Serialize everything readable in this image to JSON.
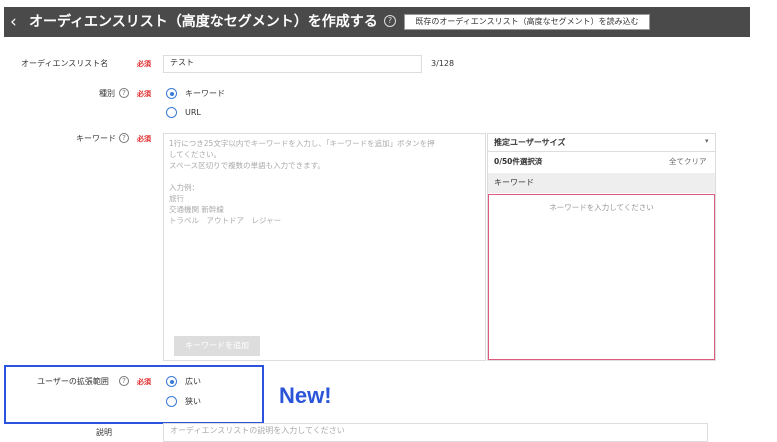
{
  "header": {
    "back_icon": "‹",
    "title": "オーディエンスリスト（高度なセグメント）を作成する",
    "help_icon": "?",
    "load_button": "既存のオーディエンスリスト（高度なセグメント）を読み込む"
  },
  "form": {
    "name": {
      "label": "オーディエンスリスト名",
      "required": "必須",
      "value": "テスト",
      "count": "3/128"
    },
    "type": {
      "label": "種別",
      "required": "必須",
      "options": [
        "キーワード",
        "URL"
      ],
      "selected": "キーワード"
    },
    "keyword": {
      "label": "キーワード",
      "required": "必須",
      "placeholder_lines": [
        "1行につき25文字以内でキーワードを入力し、「キーワードを追加」ボタンを押",
        "してください。",
        "スペース区切りで複数の単語も入力できます。",
        "",
        "入力例：",
        "旅行",
        "交通機関 新幹線",
        "トラベル　アウトドア　レジャー"
      ],
      "add_button": "キーワードを追加"
    },
    "panel": {
      "select": "推定ユーザーサイズ",
      "count": "0/50件選択済",
      "clear": "全てクリア",
      "column": "キーワード",
      "placeholder": "ネーワードを入力してください"
    },
    "range": {
      "label": "ユーザーの拡張範囲",
      "required": "必須",
      "options": [
        "広い",
        "狭い"
      ],
      "selected": "広い"
    },
    "description": {
      "label": "説明",
      "placeholder": "オーディエンスリストの説明を入力してください"
    }
  },
  "badge": {
    "new": "New!"
  },
  "colors": {
    "header": "#4a4a4a",
    "required": "#e02b2b",
    "accent": "#3a7bd5",
    "highlight": "#2b53e0",
    "panel_border": "#e05a80"
  }
}
